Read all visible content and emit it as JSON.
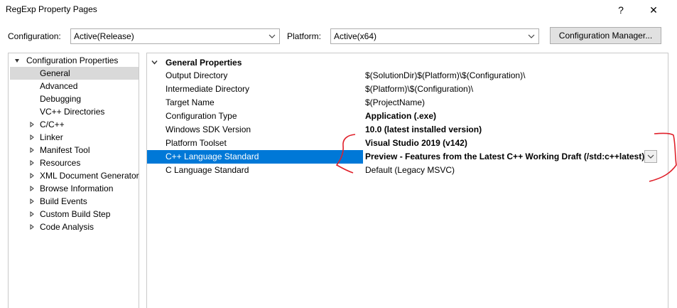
{
  "window": {
    "title": "RegExp Property Pages",
    "help_glyph": "?",
    "close_glyph": "✕"
  },
  "toolbar": {
    "configuration_label": "Configuration:",
    "configuration_value": "Active(Release)",
    "platform_label": "Platform:",
    "platform_value": "Active(x64)",
    "config_manager_label": "Configuration Manager..."
  },
  "tree": {
    "root": "Configuration Properties",
    "items": [
      {
        "label": "General",
        "selected": true,
        "expandable": false
      },
      {
        "label": "Advanced",
        "expandable": false
      },
      {
        "label": "Debugging",
        "expandable": false
      },
      {
        "label": "VC++ Directories",
        "expandable": false
      },
      {
        "label": "C/C++",
        "expandable": true
      },
      {
        "label": "Linker",
        "expandable": true
      },
      {
        "label": "Manifest Tool",
        "expandable": true
      },
      {
        "label": "Resources",
        "expandable": true
      },
      {
        "label": "XML Document Generator",
        "expandable": true
      },
      {
        "label": "Browse Information",
        "expandable": true
      },
      {
        "label": "Build Events",
        "expandable": true
      },
      {
        "label": "Custom Build Step",
        "expandable": true
      },
      {
        "label": "Code Analysis",
        "expandable": true
      }
    ]
  },
  "properties": {
    "category": "General Properties",
    "rows": [
      {
        "name": "Output Directory",
        "value": "$(SolutionDir)$(Platform)\\$(Configuration)\\",
        "bold": false
      },
      {
        "name": "Intermediate Directory",
        "value": "$(Platform)\\$(Configuration)\\",
        "bold": false
      },
      {
        "name": "Target Name",
        "value": "$(ProjectName)",
        "bold": false
      },
      {
        "name": "Configuration Type",
        "value": "Application (.exe)",
        "bold": true
      },
      {
        "name": "Windows SDK Version",
        "value": "10.0 (latest installed version)",
        "bold": true
      },
      {
        "name": "Platform Toolset",
        "value": "Visual Studio 2019 (v142)",
        "bold": true
      },
      {
        "name": "C++ Language Standard",
        "value": "Preview - Features from the Latest C++ Working Draft (/std:c++latest)",
        "bold": true,
        "selected": true
      },
      {
        "name": "C Language Standard",
        "value": "Default (Legacy MSVC)",
        "bold": false
      }
    ]
  },
  "colors": {
    "selection": "#0078d7",
    "annotation": "#e0202a"
  }
}
